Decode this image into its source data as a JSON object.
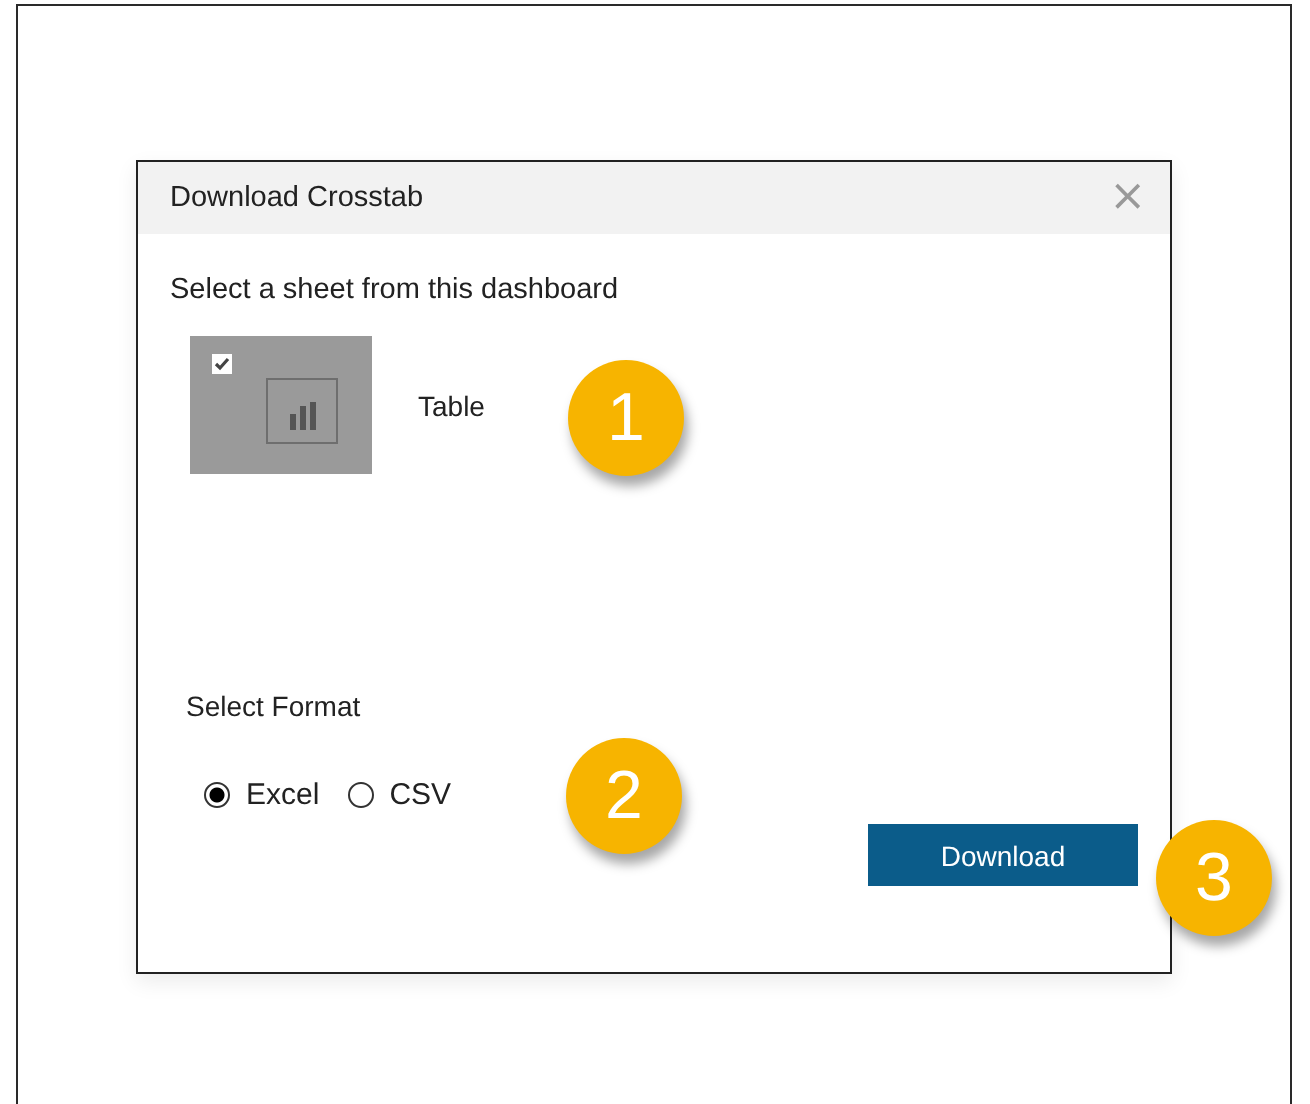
{
  "dialog": {
    "title": "Download Crosstab",
    "close": "×"
  },
  "sheet_section": {
    "label": "Select a sheet from this dashboard",
    "sheets": [
      {
        "label": "Table",
        "checked": true
      }
    ]
  },
  "format_section": {
    "label": "Select Format",
    "formats": [
      {
        "label": "Excel",
        "selected": true
      },
      {
        "label": "CSV",
        "selected": false
      }
    ]
  },
  "download_button": "Download",
  "callouts": [
    "1",
    "2",
    "3"
  ]
}
